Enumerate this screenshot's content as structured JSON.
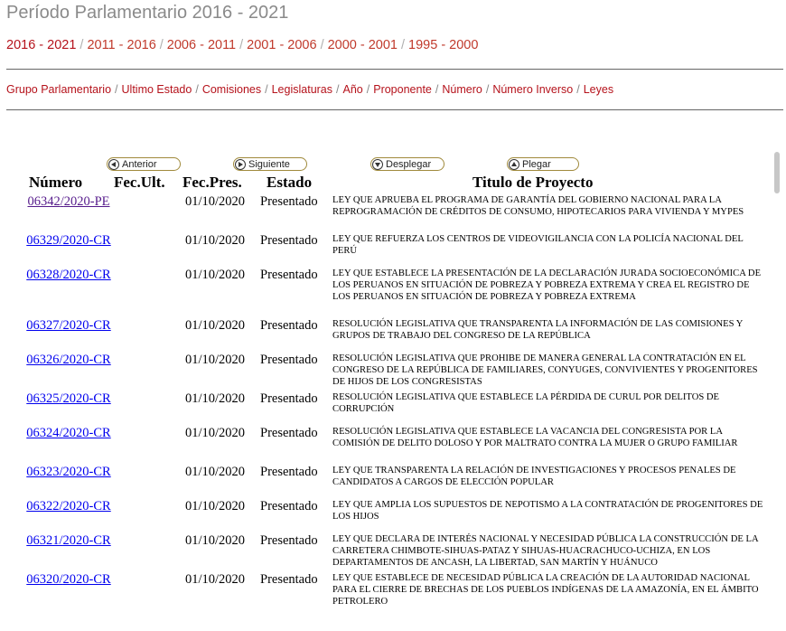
{
  "title": "Período Parlamentario 2016 - 2021",
  "periods": [
    "2016 - 2021",
    "2011 - 2016",
    "2006 - 2011",
    "2001 - 2006",
    "2000 - 2001",
    "1995 - 2000"
  ],
  "filters": [
    "Grupo Parlamentario",
    "Ultimo Estado",
    "Comisiones",
    "Legislaturas",
    "Año",
    "Proponente",
    "Número",
    "Número Inverso",
    "Leyes"
  ],
  "nav": {
    "previous": "Anterior",
    "next": "Siguiente",
    "expand": "Desplegar",
    "collapse": "Plegar"
  },
  "columns": {
    "number": "Número",
    "last_date": "Fec.Ult.",
    "pres_date": "Fec.Pres.",
    "status": "Estado",
    "title": "Titulo de Proyecto"
  },
  "rows": [
    {
      "id": "06342",
      "suffix": "2020-PE",
      "visited": true,
      "date": "01/10/2020",
      "status": "Presentado",
      "title": "LEY QUE APRUEBA EL PROGRAMA DE GARANTÍA DEL GOBIERNO NACIONAL PARA LA REPROGRAMACIÓN DE CRÉDITOS DE CONSUMO, HIPOTECARIOS PARA VIVIENDA Y MYPES"
    },
    {
      "id": "06329",
      "suffix": "2020-CR",
      "visited": false,
      "date": "01/10/2020",
      "status": "Presentado",
      "title": "LEY QUE REFUERZA LOS CENTROS DE VIDEOVIGILANCIA CON LA POLICÍA NACIONAL DEL PERÚ"
    },
    {
      "id": "06328",
      "suffix": "2020-CR",
      "visited": false,
      "date": "01/10/2020",
      "status": "Presentado",
      "title": "LEY QUE ESTABLECE LA PRESENTACIÓN DE LA DECLARACIÓN JURADA SOCIOECONÓMICA DE LOS PERUANOS EN SITUACIÓN DE POBREZA Y POBREZA EXTREMA Y CREA EL REGISTRO DE LOS PERUANOS EN SITUACIÓN DE POBREZA Y POBREZA EXTREMA"
    },
    {
      "id": "06327",
      "suffix": "2020-CR",
      "visited": false,
      "date": "01/10/2020",
      "status": "Presentado",
      "title": "RESOLUCIÓN LEGISLATIVA QUE TRANSPARENTA LA INFORMACIÓN DE LAS COMISIONES Y GRUPOS DE TRABAJO DEL CONGRESO DE LA REPÚBLICA"
    },
    {
      "id": "06326",
      "suffix": "2020-CR",
      "visited": false,
      "date": "01/10/2020",
      "status": "Presentado",
      "title": "RESOLUCIÓN LEGISLATIVA QUE PROHIBE DE MANERA GENERAL LA CONTRATACIÓN EN EL CONGRESO DE LA REPÚBLICA DE FAMILIARES, CONYUGES, CONVIVIENTES Y PROGENITORES DE HIJOS DE LOS CONGRESISTAS"
    },
    {
      "id": "06325",
      "suffix": "2020-CR",
      "visited": false,
      "date": "01/10/2020",
      "status": "Presentado",
      "title": "RESOLUCIÓN LEGISLATIVA QUE ESTABLECE LA PÉRDIDA DE CURUL POR DELITOS DE CORRUPCIÓN"
    },
    {
      "id": "06324",
      "suffix": "2020-CR",
      "visited": false,
      "date": "01/10/2020",
      "status": "Presentado",
      "title": "RESOLUCIÓN LEGISLATIVA QUE ESTABLECE LA VACANCIA DEL CONGRESISTA POR LA COMISIÓN DE DELITO DOLOSO Y POR MALTRATO CONTRA LA MUJER O GRUPO FAMILIAR"
    },
    {
      "id": "06323",
      "suffix": "2020-CR",
      "visited": false,
      "date": "01/10/2020",
      "status": "Presentado",
      "title": "LEY QUE TRANSPARENTA LA RELACIÓN DE INVESTIGACIONES Y PROCESOS PENALES DE CANDIDATOS A CARGOS DE ELECCIÓN POPULAR"
    },
    {
      "id": "06322",
      "suffix": "2020-CR",
      "visited": false,
      "date": "01/10/2020",
      "status": "Presentado",
      "title": "LEY QUE AMPLIA LOS SUPUESTOS DE NEPOTISMO A LA CONTRATACIÓN DE PROGENITORES DE LOS HIJOS"
    },
    {
      "id": "06321",
      "suffix": "2020-CR",
      "visited": false,
      "date": "01/10/2020",
      "status": "Presentado",
      "title": "LEY QUE DECLARA DE INTERÉS NACIONAL Y NECESIDAD PÚBLICA LA CONSTRUCCIÓN DE LA CARRETERA CHIMBOTE-SIHUAS-PATAZ Y SIHUAS-HUACRACHUCO-UCHIZA, EN LOS DEPARTAMENTOS DE ANCASH, LA LIBERTAD, SAN MARTÍN Y HUÁNUCO"
    },
    {
      "id": "06320",
      "suffix": "2020-CR",
      "visited": false,
      "date": "01/10/2020",
      "status": "Presentado",
      "title": "LEY QUE ESTABLECE DE NECESIDAD PÚBLICA LA CREACIÓN DE LA AUTORIDAD NACIONAL PARA EL CIERRE DE BRECHAS DE LOS PUEBLOS INDÍGENAS DE LA AMAZONÍA, EN EL ÁMBITO PETROLERO"
    }
  ],
  "colors": {
    "link": "#0000ee",
    "visited": "#551a8b",
    "accent": "#b5121b"
  }
}
